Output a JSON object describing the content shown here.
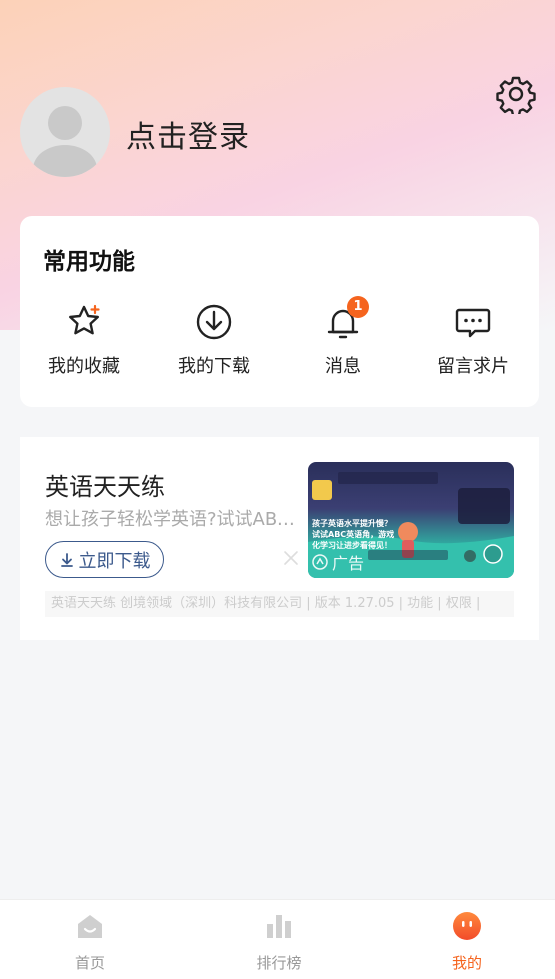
{
  "profile": {
    "login_text": "点击登录"
  },
  "common": {
    "title": "常用功能",
    "items": [
      {
        "label": "我的收藏",
        "icon": "star-icon"
      },
      {
        "label": "我的下载",
        "icon": "download-icon"
      },
      {
        "label": "消息",
        "icon": "bell-icon",
        "badge": "1"
      },
      {
        "label": "留言求片",
        "icon": "message-icon"
      }
    ]
  },
  "ad": {
    "title": "英语天天练",
    "desc": "想让孩子轻松学英语?试试ABC英语角",
    "button": "立即下载",
    "tag": "广告",
    "footer": "英语天天练 创境领域（深圳）科技有限公司 | 版本 1.27.05 | 功能 | 权限 |",
    "image_text_1": "孩子英语水平提升慢？",
    "image_text_2": "试试ABC英语角，游戏",
    "image_text_3": "化学习让进步看得见！"
  },
  "tabbar": {
    "items": [
      {
        "label": "首页",
        "icon": "home-icon"
      },
      {
        "label": "排行榜",
        "icon": "chart-icon"
      },
      {
        "label": "我的",
        "icon": "profile-face-icon"
      }
    ],
    "active_color": "#f5641e"
  }
}
